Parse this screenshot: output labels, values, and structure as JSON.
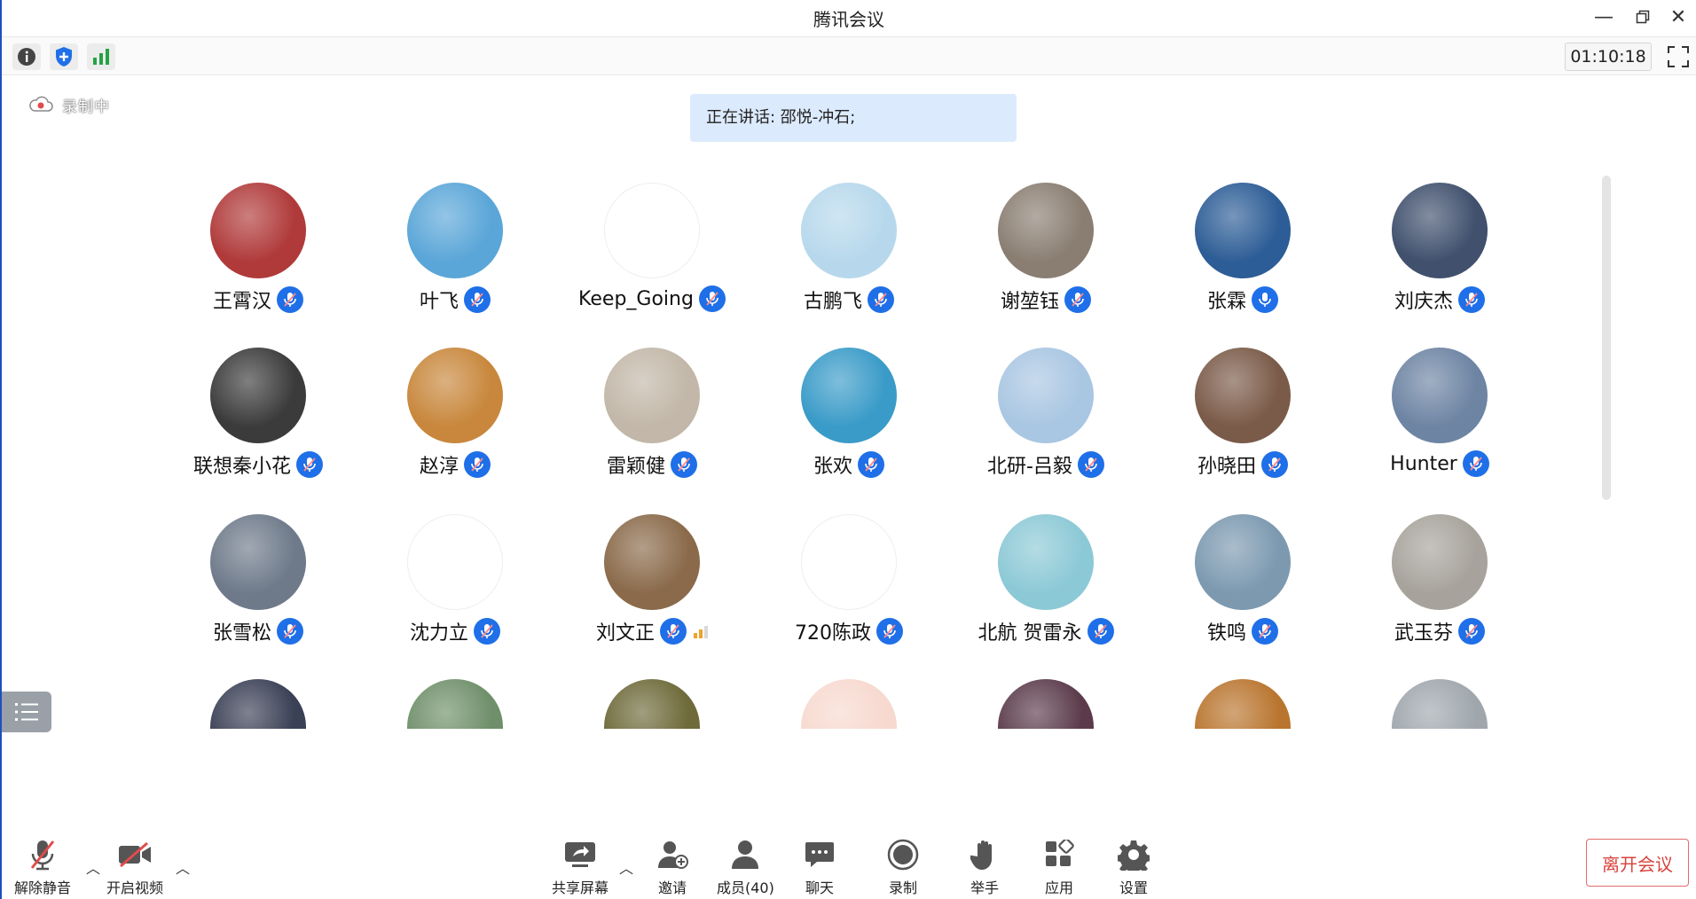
{
  "window": {
    "title": "腾讯会议"
  },
  "toolbar": {
    "timer": "01:10:18"
  },
  "recording": {
    "label": "录制中"
  },
  "speaking": {
    "text": "正在讲话: 邵悦-冲石;"
  },
  "participants": [
    {
      "name": "王霄汉",
      "mic": "muted",
      "avatar": "#b03a3a"
    },
    {
      "name": "叶飞",
      "mic": "muted",
      "avatar": "#5aa6d8"
    },
    {
      "name": "Keep_Going",
      "mic": "muted",
      "avatar": "#ffffff"
    },
    {
      "name": "古鹏飞",
      "mic": "muted",
      "avatar": "#b7d8ec"
    },
    {
      "name": "谢堃钰",
      "mic": "muted",
      "avatar": "#8a7e72"
    },
    {
      "name": "张霖",
      "mic": "active",
      "avatar": "#2d5d96"
    },
    {
      "name": "刘庆杰",
      "mic": "muted",
      "avatar": "#40506d"
    },
    {
      "name": "联想秦小花",
      "mic": "muted",
      "avatar": "#3b3b3b"
    },
    {
      "name": "赵淳",
      "mic": "muted",
      "avatar": "#c8873c"
    },
    {
      "name": "雷颖健",
      "mic": "muted",
      "avatar": "#c2b7a8"
    },
    {
      "name": "张欢",
      "mic": "muted",
      "avatar": "#3a9bc8"
    },
    {
      "name": "北研-吕毅",
      "mic": "muted",
      "avatar": "#a9c6e2"
    },
    {
      "name": "孙晓田",
      "mic": "muted",
      "avatar": "#7a5a48"
    },
    {
      "name": "Hunter",
      "mic": "muted",
      "avatar": "#6d84a3"
    },
    {
      "name": "张雪松",
      "mic": "muted",
      "avatar": "#6e7a8a"
    },
    {
      "name": "沈力立",
      "mic": "muted",
      "avatar": "#ffffff"
    },
    {
      "name": "刘文正",
      "mic": "muted",
      "avatar": "#8a6a4a",
      "bars": 2
    },
    {
      "name": "720陈政",
      "mic": "muted",
      "avatar": "#ffffff"
    },
    {
      "name": "北航 贺雷永",
      "mic": "muted",
      "avatar": "#8cc9d6"
    },
    {
      "name": "铁鸣",
      "mic": "muted",
      "avatar": "#7c99b0"
    },
    {
      "name": "武玉芬",
      "mic": "muted",
      "avatar": "#a7a39c"
    },
    {
      "name": "",
      "mic": "none",
      "avatar": "#3a4055"
    },
    {
      "name": "",
      "mic": "none",
      "avatar": "#6f8f6a"
    },
    {
      "name": "",
      "mic": "none",
      "avatar": "#6e6a3a"
    },
    {
      "name": "",
      "mic": "none",
      "avatar": "#f7d9cf"
    },
    {
      "name": "",
      "mic": "none",
      "avatar": "#5b3b4b"
    },
    {
      "name": "",
      "mic": "none",
      "avatar": "#b9752f"
    },
    {
      "name": "",
      "mic": "none",
      "avatar": "#9fa7ad"
    }
  ],
  "bottom": {
    "unmute": "解除静音",
    "video": "开启视频",
    "share": "共享屏幕",
    "invite": "邀请",
    "members": "成员(40)",
    "chat": "聊天",
    "record": "录制",
    "raise": "举手",
    "apps": "应用",
    "settings": "设置",
    "leave": "离开会议"
  },
  "colors": {
    "accent": "#1f6fe8",
    "leave": "#d9433d",
    "banner": "#dceafd"
  }
}
